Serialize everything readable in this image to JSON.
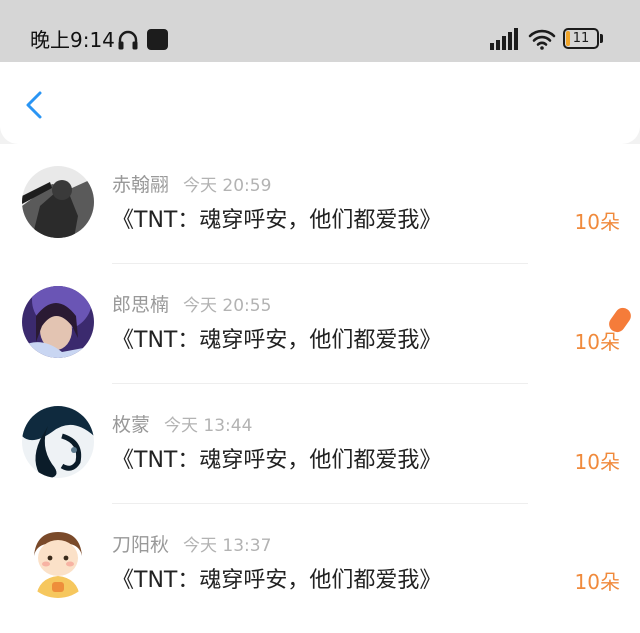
{
  "status_bar": {
    "time": "晚上9:14",
    "battery_level": "11",
    "headphone_icon": "headphone-icon",
    "signal_icon": "signal-icon",
    "wifi_icon": "wifi-icon"
  },
  "header": {
    "back_icon": "chevron-left-icon",
    "accent_color": "#2a95f4"
  },
  "colors": {
    "count": "#f08a3c",
    "name": "#999999",
    "message": "#222222"
  },
  "list": {
    "rows": [
      {
        "name": "赤翰翮",
        "time": "今天 20:59",
        "message": "《TNT：魂穿呼安，他们都爱我》",
        "count": "10朵"
      },
      {
        "name": "郎思楠",
        "time": "今天 20:55",
        "message": "《TNT：魂穿呼安，他们都爱我》",
        "count": "10朵"
      },
      {
        "name": "枚蒙",
        "time": "今天 13:44",
        "message": "《TNT：魂穿呼安，他们都爱我》",
        "count": "10朵"
      },
      {
        "name": "刀阳秋",
        "time": "今天 13:37",
        "message": "《TNT：魂穿呼安，他们都爱我》",
        "count": "10朵"
      }
    ]
  }
}
